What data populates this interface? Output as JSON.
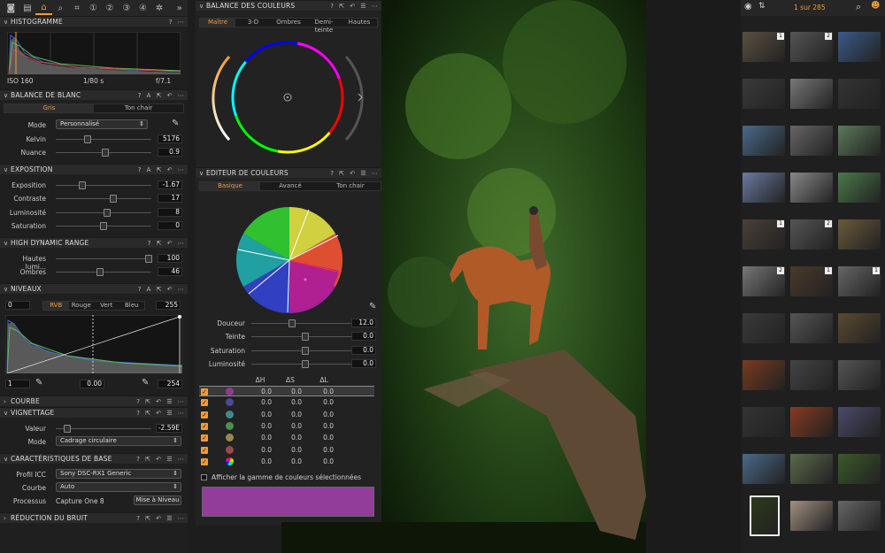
{
  "toolbar": {
    "counter": "1 sur 285"
  },
  "histogram": {
    "title": "HISTOGRAMME",
    "iso": "ISO 160",
    "shutter": "1/80 s",
    "aperture": "f/7.1"
  },
  "white_balance": {
    "title": "BALANCE DE BLANC",
    "tab_gray": "Gris",
    "tab_skin": "Ton chair",
    "mode_label": "Mode",
    "mode_value": "Personnalisé",
    "kelvin_label": "Kelvin",
    "kelvin_value": "5176",
    "kelvin_pos": 0.33,
    "tint_label": "Nuance",
    "tint_value": "0.9",
    "tint_pos": 0.52
  },
  "exposure": {
    "title": "EXPOSITION",
    "rows": [
      {
        "label": "Exposition",
        "value": "-1.67",
        "pos": 0.28
      },
      {
        "label": "Contraste",
        "value": "17",
        "pos": 0.6
      },
      {
        "label": "Luminosité",
        "value": "8",
        "pos": 0.54
      },
      {
        "label": "Saturation",
        "value": "0",
        "pos": 0.5
      }
    ]
  },
  "hdr": {
    "title": "HIGH DYNAMIC RANGE",
    "rows": [
      {
        "label": "Hautes lumi...",
        "value": "100",
        "pos": 0.97
      },
      {
        "label": "Ombres",
        "value": "46",
        "pos": 0.46
      }
    ]
  },
  "levels": {
    "title": "NIVEAUX",
    "low": "0",
    "high": "255",
    "tabs": [
      "RVB",
      "Rouge",
      "Vert",
      "Bleu"
    ],
    "out_low": "1",
    "mid": "0.00",
    "out_high": "254"
  },
  "curve": {
    "title": "COURBE"
  },
  "vignetting": {
    "title": "VIGNETTAGE",
    "amount_label": "Valeur",
    "amount_value": "-2.59E",
    "amount_pos": 0.12,
    "mode_label": "Mode",
    "mode_value": "Cadrage circulaire"
  },
  "base": {
    "title": "CARACTÉRISTIQUES DE BASE",
    "icc_label": "Profil ICC",
    "icc_value": "Sony DSC-RX1 Generic",
    "curve_label": "Courbe",
    "curve_value": "Auto",
    "process_label": "Processus",
    "process_value": "Capture One 8",
    "update_btn": "Mise à Niveau"
  },
  "noise": {
    "title": "RÉDUCTION DU BRUIT"
  },
  "color_balance": {
    "title": "BALANCE DES COULEURS",
    "tabs": [
      "Maître",
      "3-D",
      "Ombres",
      "Demi-teinte",
      "Hautes"
    ]
  },
  "color_editor": {
    "title": "EDITEUR DE COULEURS",
    "tabs": [
      "Basique",
      "Avancé",
      "Ton chair"
    ],
    "sliders": [
      {
        "label": "Douceur",
        "value": "12.0",
        "pos": 0.38
      },
      {
        "label": "Teinte",
        "value": "0.0",
        "pos": 0.5
      },
      {
        "label": "Saturation",
        "value": "0.0",
        "pos": 0.5
      },
      {
        "label": "Luminosité",
        "value": "0.0",
        "pos": 0.5
      }
    ],
    "headers": [
      "ΔH",
      "ΔS",
      "ΔL"
    ],
    "rows": [
      {
        "color": "#8e3a96",
        "dh": "0.0",
        "ds": "0.0",
        "dl": "0.0"
      },
      {
        "color": "#4a4a9a",
        "dh": "0.0",
        "ds": "0.0",
        "dl": "0.0"
      },
      {
        "color": "#3f8a8c",
        "dh": "0.0",
        "ds": "0.0",
        "dl": "0.0"
      },
      {
        "color": "#4f8e4f",
        "dh": "0.0",
        "ds": "0.0",
        "dl": "0.0"
      },
      {
        "color": "#958a4a",
        "dh": "0.0",
        "ds": "0.0",
        "dl": "0.0"
      },
      {
        "color": "#9a4a4a",
        "dh": "0.0",
        "ds": "0.0",
        "dl": "0.0"
      },
      {
        "color": "rainbow",
        "dh": "0.0",
        "ds": "0.0",
        "dl": "0.0"
      }
    ],
    "checkbox_label": "Afficher la gamme de couleurs sélectionnées",
    "swatch": "#933d9a"
  },
  "accent": "#f29b38"
}
